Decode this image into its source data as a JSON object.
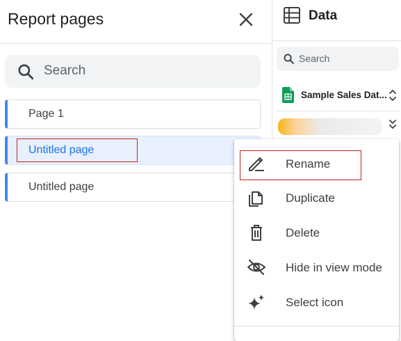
{
  "report_panel": {
    "title": "Report pages",
    "search_placeholder": "Search",
    "pages": [
      {
        "label": "Page 1"
      },
      {
        "label": "Untitled page",
        "selected": true
      },
      {
        "label": "Untitled page"
      }
    ]
  },
  "data_panel": {
    "title": "Data",
    "search_placeholder": "Search",
    "source_name": "Sample Sales Dat..."
  },
  "context_menu": {
    "items": [
      {
        "label": "Rename",
        "icon": "pencil-icon"
      },
      {
        "label": "Duplicate",
        "icon": "copy-icon"
      },
      {
        "label": "Delete",
        "icon": "trash-icon"
      },
      {
        "label": "Hide in view mode",
        "icon": "eye-off-icon"
      },
      {
        "label": "Select icon",
        "icon": "sparkle-icon"
      }
    ]
  },
  "colors": {
    "accent": "#1a73e8",
    "page_indicator": "#4285f4",
    "selected_bg": "#e8f0fe",
    "highlight_outline": "#c5221f",
    "sheets_green": "#0f9d58"
  }
}
